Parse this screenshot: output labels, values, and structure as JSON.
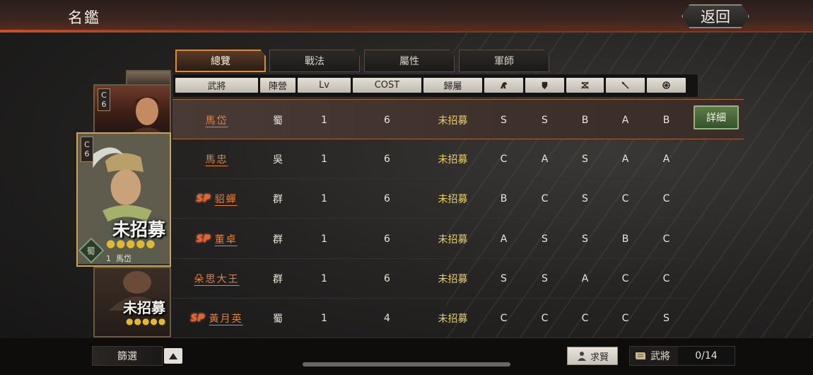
{
  "header": {
    "title": "名鑑",
    "back_label": "返回"
  },
  "tabs": [
    {
      "label": "總覽",
      "active": true
    },
    {
      "label": "戰法",
      "active": false
    },
    {
      "label": "屬性",
      "active": false
    },
    {
      "label": "軍師",
      "active": false
    }
  ],
  "columns": {
    "general": "武將",
    "camp": "陣營",
    "level": "Lv",
    "cost": "COST",
    "ownership": "歸屬",
    "icon_cavalry": "horse-icon",
    "icon_shield": "shield-icon",
    "icon_bow": "crossed-bows-icon",
    "icon_spear": "spear-icon",
    "icon_siege": "siege-wheel-icon"
  },
  "rows": [
    {
      "sp": "",
      "name": "馬岱",
      "camp": "蜀",
      "level": "1",
      "cost": "6",
      "status": "未招募",
      "r1": "S",
      "r2": "S",
      "r3": "B",
      "r4": "A",
      "r5": "B"
    },
    {
      "sp": "",
      "name": "馬忠",
      "camp": "吳",
      "level": "1",
      "cost": "6",
      "status": "未招募",
      "r1": "C",
      "r2": "A",
      "r3": "S",
      "r4": "A",
      "r5": "A"
    },
    {
      "sp": "SP",
      "name": "貂蟬",
      "camp": "群",
      "level": "1",
      "cost": "6",
      "status": "未招募",
      "r1": "B",
      "r2": "C",
      "r3": "S",
      "r4": "C",
      "r5": "C"
    },
    {
      "sp": "SP",
      "name": "董卓",
      "camp": "群",
      "level": "1",
      "cost": "6",
      "status": "未招募",
      "r1": "A",
      "r2": "S",
      "r3": "S",
      "r4": "B",
      "r5": "C"
    },
    {
      "sp": "",
      "name": "朵思大王",
      "camp": "群",
      "level": "1",
      "cost": "6",
      "status": "未招募",
      "r1": "S",
      "r2": "S",
      "r3": "A",
      "r4": "C",
      "r5": "C"
    },
    {
      "sp": "SP",
      "name": "黃月英",
      "camp": "蜀",
      "level": "1",
      "cost": "4",
      "status": "未招募",
      "r1": "C",
      "r2": "C",
      "r3": "C",
      "r4": "C",
      "r5": "S"
    }
  ],
  "detail_label": "詳細",
  "selected_card": {
    "rank_letter": "C",
    "rank_num": "6",
    "status": "未招募",
    "stars": "●●●●●",
    "faction": "蜀",
    "level": "1",
    "name": "馬岱"
  },
  "side_cards": [
    {
      "rank_letter": "C",
      "rank_num": "6"
    },
    {
      "status": "未招募",
      "stars": "●●●●●"
    }
  ],
  "footer": {
    "filter_label": "篩選",
    "recruit_label": "求賢",
    "generals_label": "武將",
    "generals_count": "0/14"
  },
  "colors": {
    "accent": "#e08042",
    "gold": "#e5cd6b",
    "sp": "#ff5a2a",
    "detail": "#4d6b3c"
  }
}
